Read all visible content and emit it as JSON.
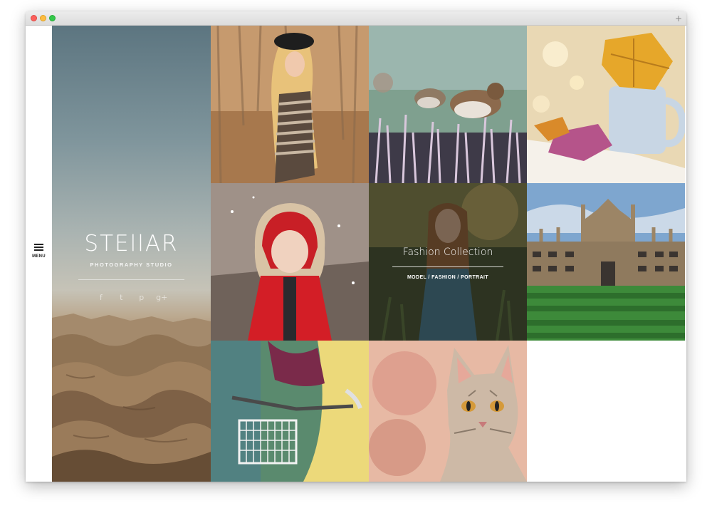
{
  "browser": {
    "new_tab_glyph": "+"
  },
  "menu": {
    "label": "MENU",
    "icon": "hamburger-icon"
  },
  "hero": {
    "title": "STEllAR",
    "subtitle": "PHOTOGRAPHY STUDIO",
    "social": [
      {
        "icon": "facebook-icon",
        "glyph": "f"
      },
      {
        "icon": "twitter-icon",
        "glyph": "t"
      },
      {
        "icon": "pinterest-icon",
        "glyph": "p"
      },
      {
        "icon": "google-plus-icon",
        "glyph": "g+"
      }
    ]
  },
  "gallery": {
    "featured": {
      "title": "Fashion Collection",
      "tags": "MODEL / FASHION / PORTRAIT"
    }
  },
  "colors": {
    "hero_top": "#5c7580",
    "hero_bottom": "#5a4834",
    "overlay": "rgba(25,25,20,0.45)"
  }
}
